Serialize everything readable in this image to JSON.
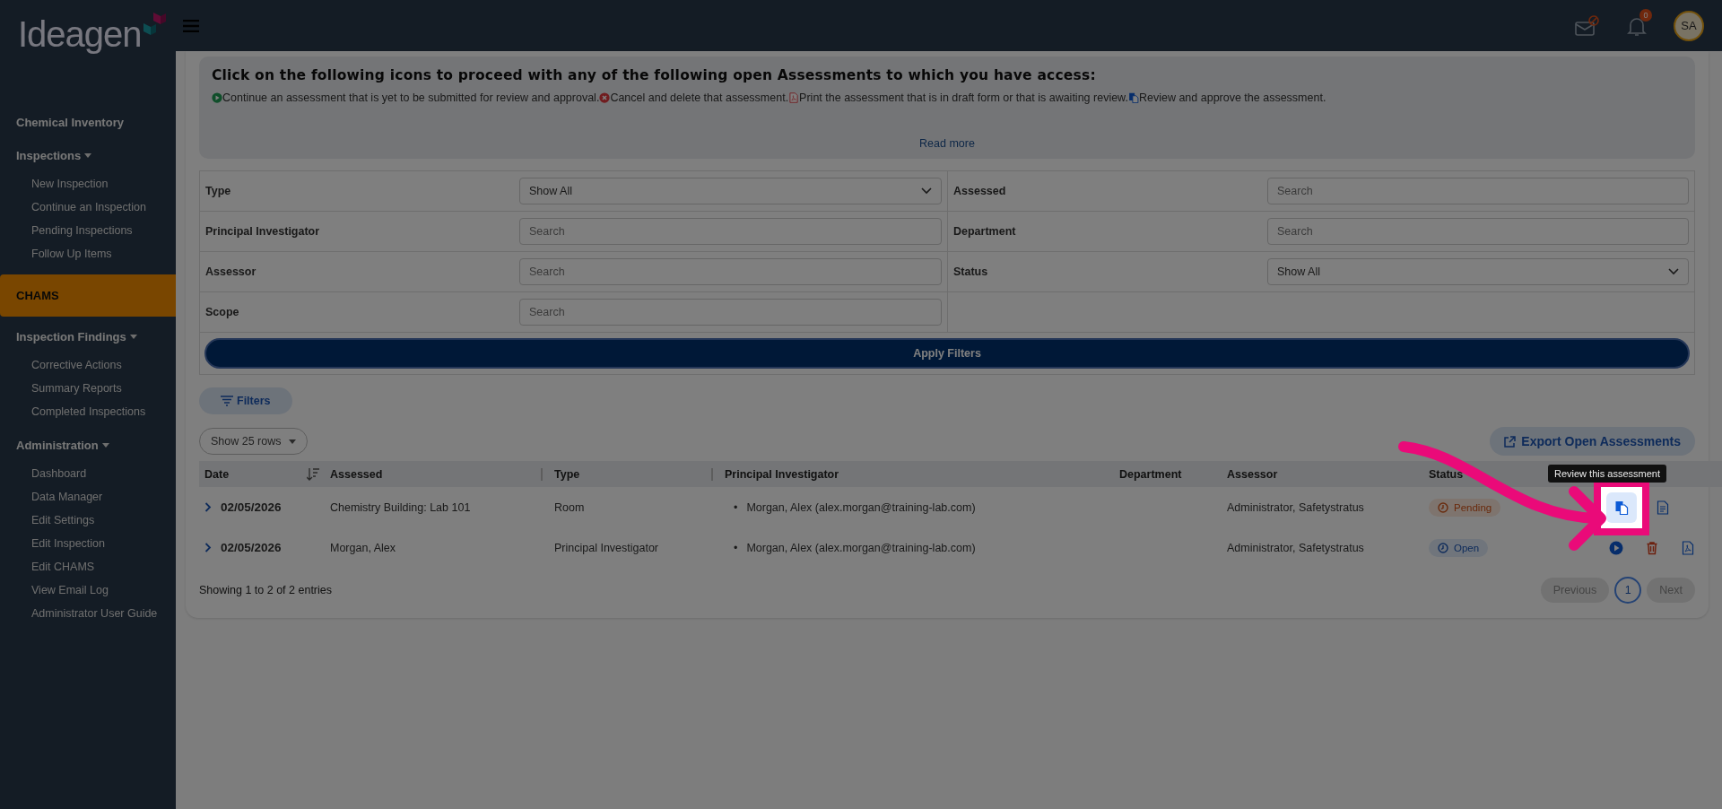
{
  "brand": {
    "logo": "Ideagen"
  },
  "topbar": {
    "notification_count": "0",
    "avatar": "SA"
  },
  "sidebar": {
    "items": [
      {
        "label": "Chemical Inventory",
        "selected": false
      },
      {
        "label": "Inspections",
        "selected": false,
        "children": [
          {
            "label": "New Inspection"
          },
          {
            "label": "Continue an Inspection"
          },
          {
            "label": "Pending Inspections"
          },
          {
            "label": "Follow Up Items"
          }
        ]
      },
      {
        "label": "CHAMS",
        "selected": true
      },
      {
        "label": "Inspection Findings",
        "selected": false,
        "children": [
          {
            "label": "Corrective Actions"
          },
          {
            "label": "Summary Reports"
          },
          {
            "label": "Completed Inspections"
          }
        ]
      },
      {
        "label": "Administration",
        "selected": false,
        "children": [
          {
            "label": "Dashboard"
          },
          {
            "label": "Data Manager"
          },
          {
            "label": "Edit Settings"
          },
          {
            "label": "Edit Inspection"
          },
          {
            "label": "Edit CHAMS"
          },
          {
            "label": "View Email Log"
          },
          {
            "label": "Administrator User Guide"
          }
        ]
      }
    ]
  },
  "info": {
    "heading": "Click on the following icons to proceed with any of the following open Assessments to which you have access:",
    "legend": [
      {
        "kind": "continue",
        "text": "Continue an assessment that is yet to be submitted for review and approval."
      },
      {
        "kind": "delete",
        "text": "Cancel and delete that assessment."
      },
      {
        "kind": "print",
        "text": "Print the assessment that is in draft form or that is awaiting review."
      },
      {
        "kind": "review",
        "text": "Review and approve the assessment."
      }
    ],
    "read_more": "Read more"
  },
  "filters": {
    "columns": [
      [
        {
          "label": "Type",
          "kind": "select",
          "value": "Show All"
        },
        {
          "label": "Principal Investigator",
          "kind": "search",
          "placeholder": "Search"
        },
        {
          "label": "Assessor",
          "kind": "search",
          "placeholder": "Search"
        },
        {
          "label": "Scope",
          "kind": "search",
          "placeholder": "Search"
        }
      ],
      [
        {
          "label": "Assessed",
          "kind": "search",
          "placeholder": "Search"
        },
        {
          "label": "Department",
          "kind": "search",
          "placeholder": "Search"
        },
        {
          "label": "Status",
          "kind": "select",
          "value": "Show All"
        }
      ]
    ],
    "apply": "Apply Filters"
  },
  "filters_toggle": "Filters",
  "page_size": "Show 25 rows",
  "export": "Export Open Assessments",
  "table": {
    "columns": [
      {
        "label": "Date",
        "sortable": true
      },
      {
        "label": "Assessed",
        "resizable": true
      },
      {
        "label": "Type",
        "resizable": true
      },
      {
        "label": "Principal Investigator"
      },
      {
        "label": "Department"
      },
      {
        "label": "Assessor"
      },
      {
        "label": "Status"
      }
    ],
    "rows": [
      {
        "date": "02/05/2026",
        "assessed": "Chemistry Building: Lab 101",
        "type": "Room",
        "investigators": [
          {
            "marker": "•",
            "name": "Morgan, Alex (alex.morgan@training-lab.com)"
          }
        ],
        "assessor": "Administrator, Safetystratus",
        "status": {
          "label": "Pending",
          "kind": "pending"
        },
        "actions": [
          {
            "kind": "review",
            "highlighted": true
          },
          {
            "kind": "document",
            "highlighted": false
          }
        ]
      },
      {
        "date": "02/05/2026",
        "assessed": "Morgan, Alex",
        "type": "Principal Investigator",
        "investigators": [
          {
            "marker": "•",
            "name": "Morgan, Alex (alex.morgan@training-lab.com)"
          }
        ],
        "assessor": "Administrator, Safetystratus",
        "status": {
          "label": "Open",
          "kind": "open"
        },
        "actions": [
          {
            "kind": "continue",
            "highlighted": false
          },
          {
            "kind": "delete",
            "highlighted": false
          },
          {
            "kind": "print",
            "highlighted": false
          }
        ]
      }
    ]
  },
  "tooltip": "Review this assessment",
  "summary": "Showing 1 to 2 of 2 entries",
  "pagination": {
    "previous": {
      "label": "Previous",
      "disabled": true
    },
    "pages": [
      {
        "label": "1",
        "selected": true
      }
    ],
    "next": {
      "label": "Next",
      "disabled": true
    }
  }
}
